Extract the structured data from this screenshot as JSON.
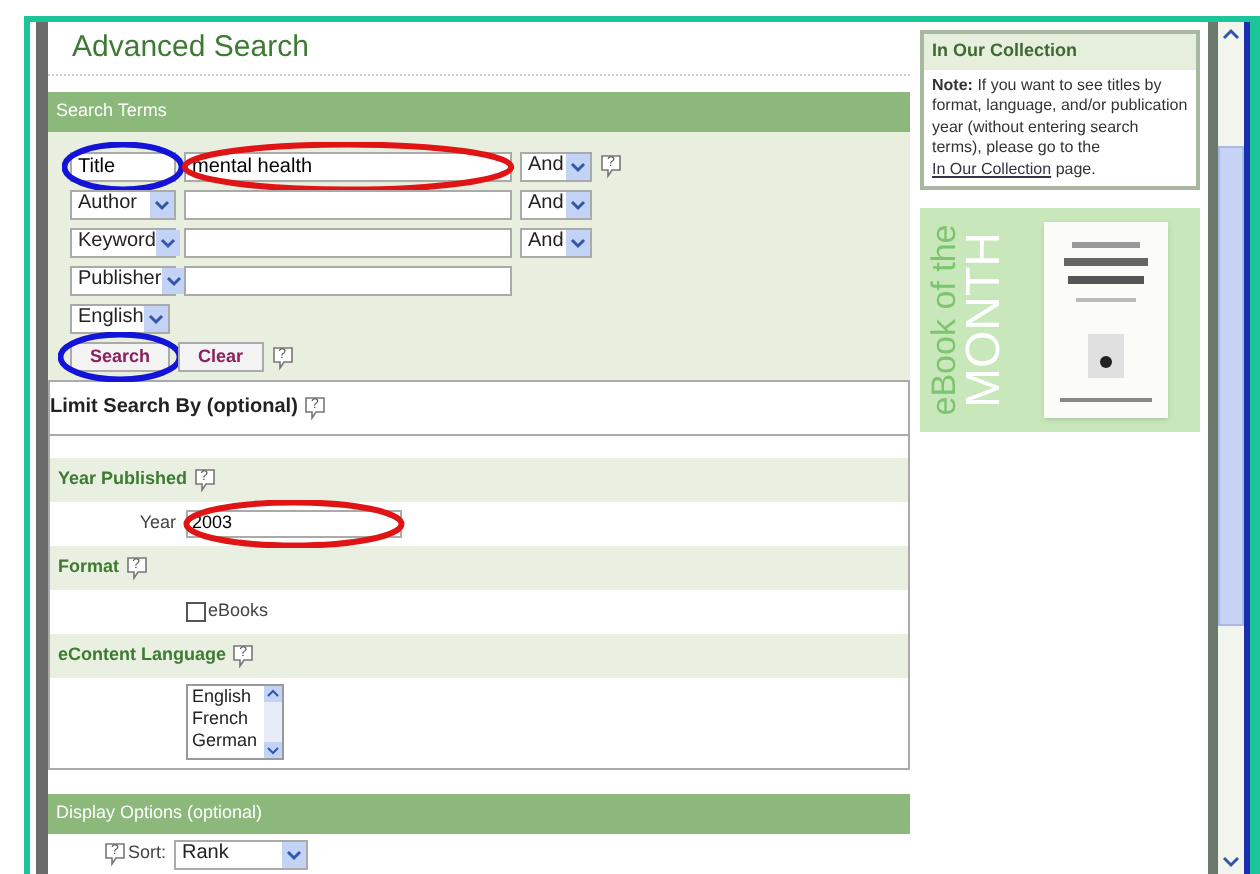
{
  "page": {
    "title": "Advanced Search"
  },
  "search_terms": {
    "heading": "Search Terms",
    "rows": [
      {
        "kind": "term",
        "field": "Title",
        "value": "mental health",
        "operator": "And",
        "help": "?",
        "field_highlight": {
          "color": "#1414d8"
        },
        "value_highlight": {
          "color": "#e01414"
        }
      },
      {
        "kind": "term",
        "field": "Author",
        "operator": "And"
      },
      {
        "kind": "term",
        "field": "Keyword",
        "operator": "And"
      },
      {
        "kind": "term",
        "field": "Publisher"
      },
      {
        "kind": "language",
        "field": "English"
      }
    ],
    "buttons": [
      {
        "label": "Search",
        "highlight": {
          "color": "#1414d8"
        }
      },
      {
        "label": "Clear"
      }
    ],
    "buttons_help": "?"
  },
  "limit": {
    "title": "Limit Search By (optional)",
    "help": "?",
    "sections": [
      {
        "kind": "year",
        "heading": "Year Published",
        "help": "?",
        "label": "Year",
        "value": "2003",
        "highlight": {
          "color": "#e01414"
        }
      },
      {
        "kind": "checkbox",
        "heading": "Format",
        "help": "?",
        "label": "eBooks",
        "checked": false
      },
      {
        "kind": "listbox",
        "heading": "eContent Language",
        "help": "?",
        "options": [
          "English",
          "French",
          "German"
        ]
      }
    ]
  },
  "display": {
    "heading": "Display Options (optional)",
    "help": "?",
    "sort_label": "Sort:",
    "sort_value": "Rank"
  },
  "sidebar": {
    "collection": {
      "heading": "In Our Collection",
      "note_label": "Note:",
      "note": "If you want to see titles by format, language, and/or publication year (without entering search terms), please go to the",
      "link": "In Our Collection",
      "after": "page."
    },
    "banner": {
      "line1": "eBook of the",
      "line2": "MONTH"
    }
  }
}
